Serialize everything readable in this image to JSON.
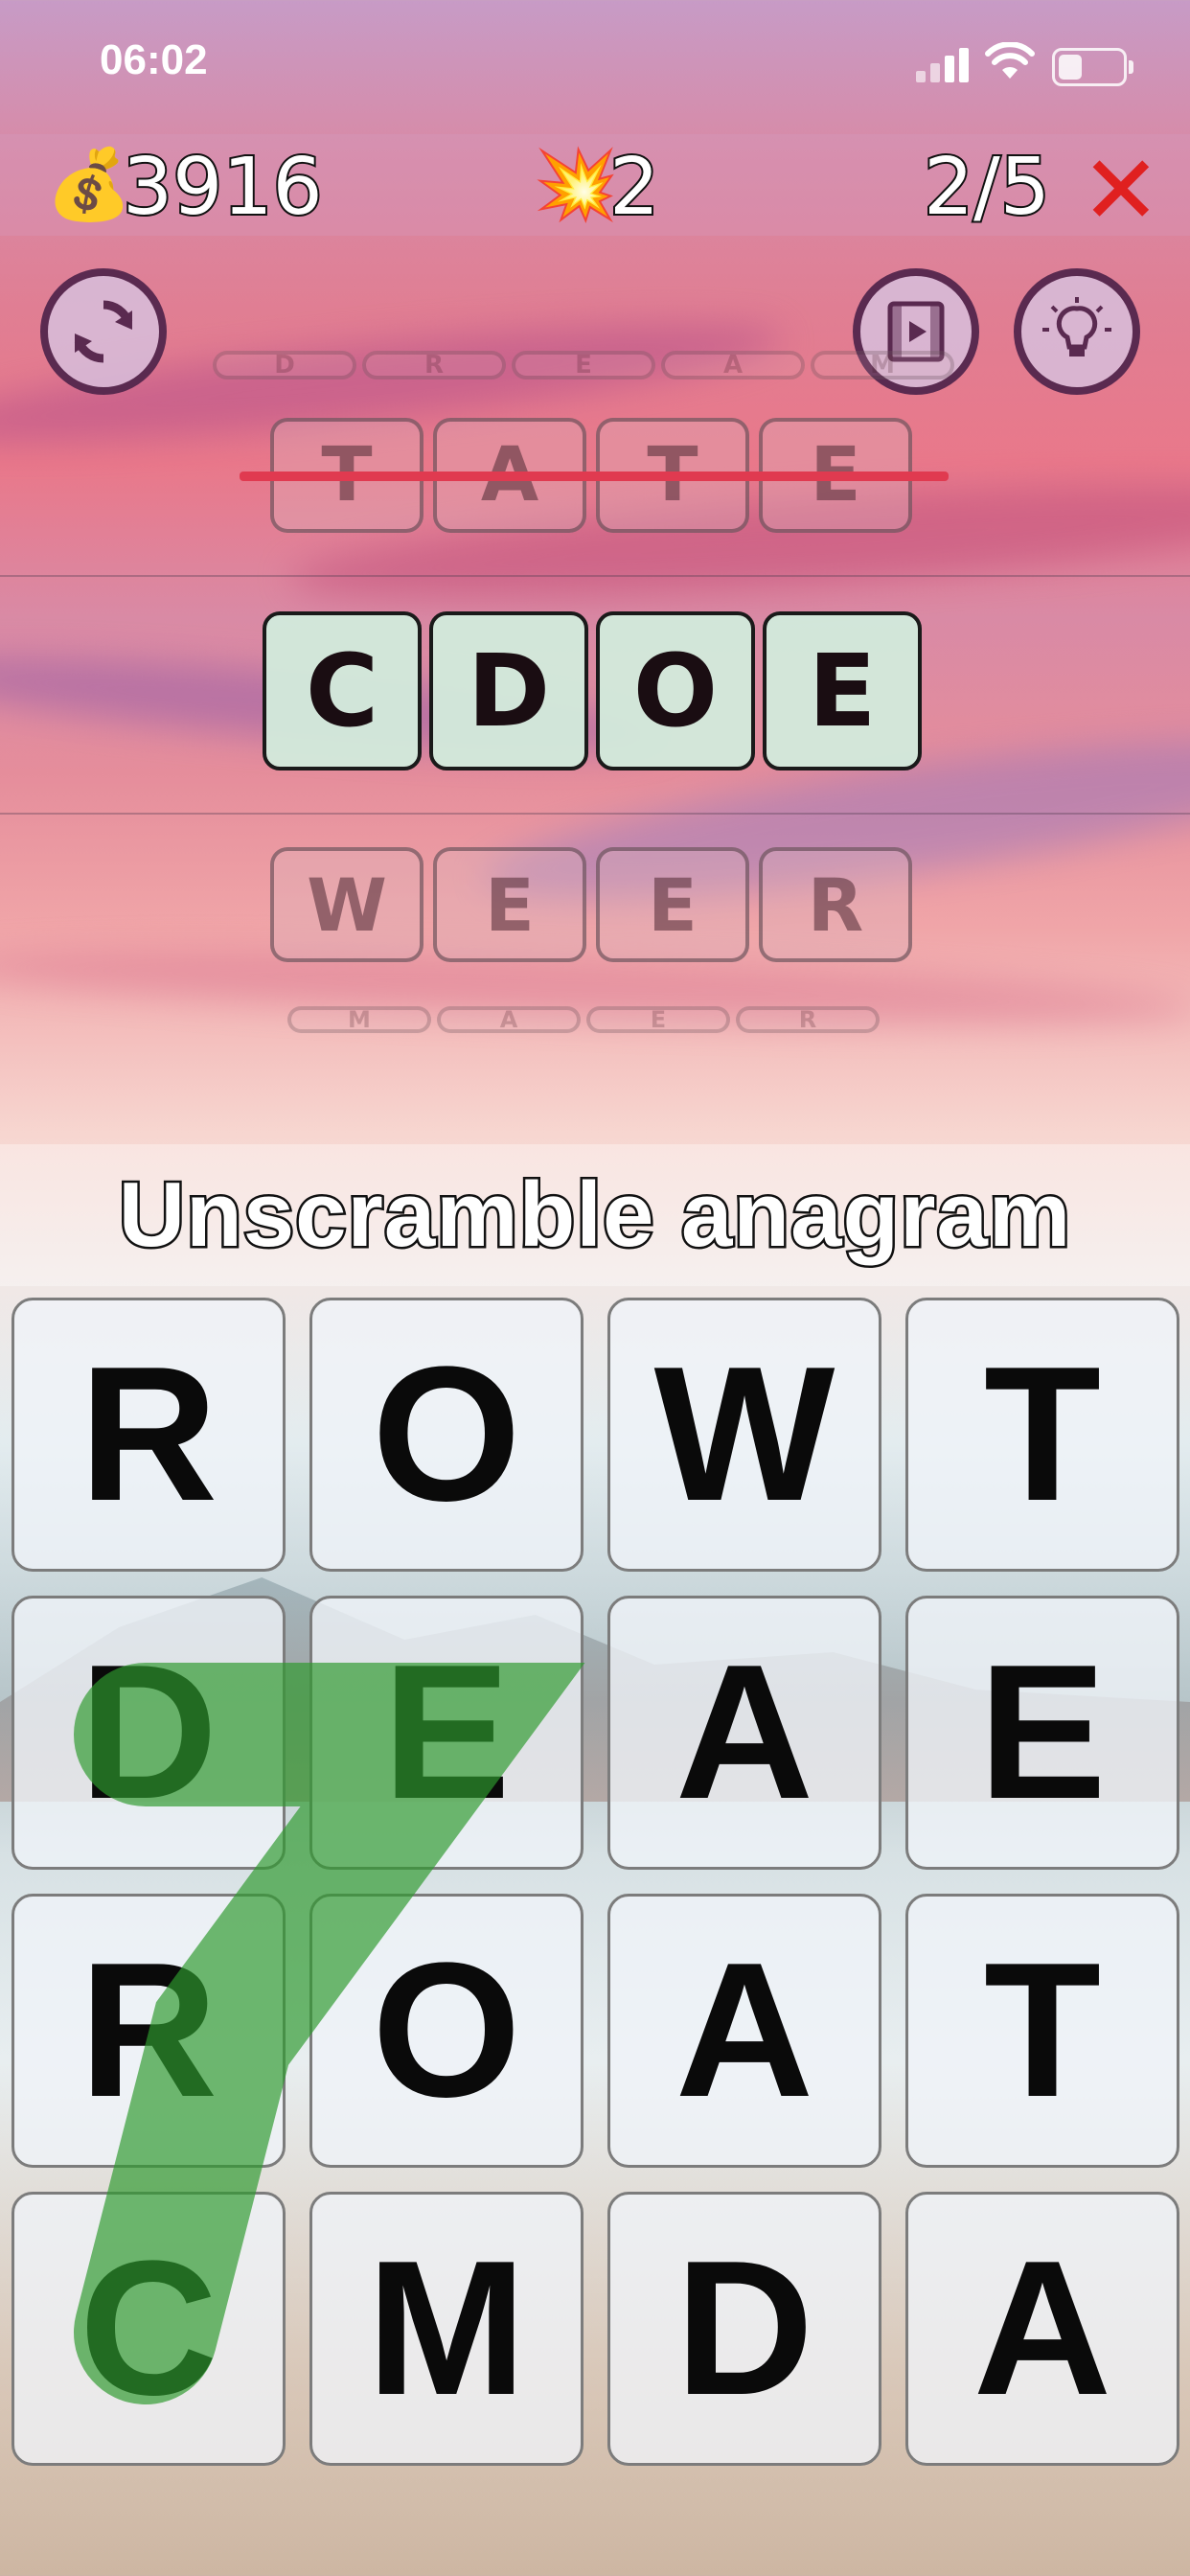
{
  "status_bar": {
    "time": "06:02"
  },
  "hud": {
    "money_icon": "money-bag",
    "money": "3916",
    "bomb_icon": "explosion",
    "bombs": "2",
    "progress": "2/5",
    "close_icon": "red-x"
  },
  "buttons": {
    "refresh_icon": "refresh-cycle",
    "video_icon": "film-play",
    "hint_icon": "lightbulb"
  },
  "solved_words": [
    {
      "letters": [
        "D",
        "R",
        "E",
        "A",
        "M"
      ]
    },
    {
      "letters": [
        "T",
        "A",
        "T",
        "E"
      ]
    }
  ],
  "current_word": {
    "letters": [
      "C",
      "D",
      "O",
      "E"
    ]
  },
  "upcoming_words": [
    {
      "letters": [
        "W",
        "E",
        "E",
        "R"
      ]
    },
    {
      "letters": [
        "M",
        "A",
        "E",
        "R"
      ]
    }
  ],
  "instruction": "Unscramble anagram",
  "grid": [
    [
      "R",
      "O",
      "W",
      "T"
    ],
    [
      "D",
      "E",
      "A",
      "E"
    ],
    [
      "R",
      "O",
      "A",
      "T"
    ],
    [
      "C",
      "M",
      "D",
      "A"
    ]
  ],
  "colors": {
    "accent_border": "#5a2a50",
    "strike": "#e03a50",
    "path_green": "#2e9a2e",
    "close_red": "#e02020"
  }
}
